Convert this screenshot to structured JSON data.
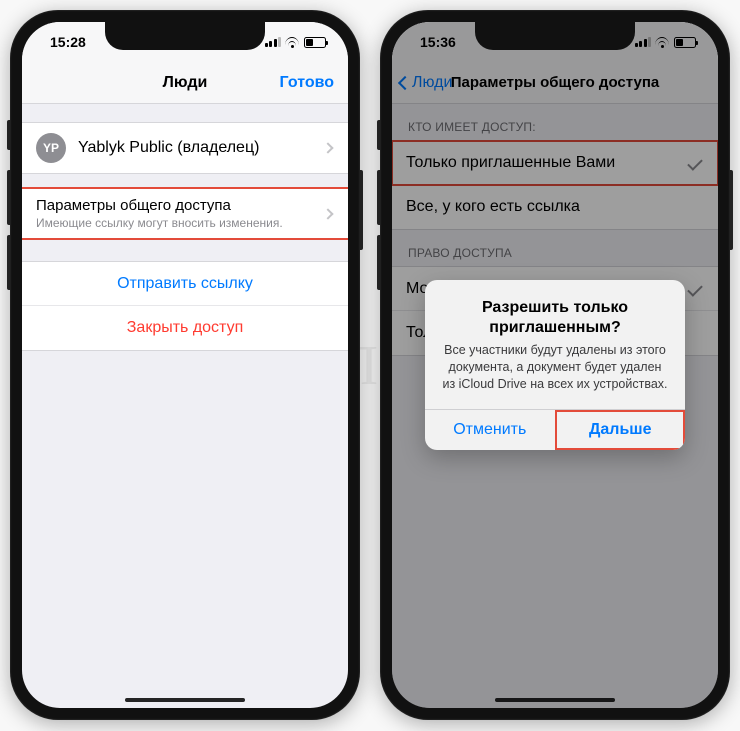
{
  "left": {
    "status_time": "15:28",
    "nav_title": "Люди",
    "nav_done": "Готово",
    "owner": {
      "initials": "YP",
      "name": "Yablyk Public (владелец)"
    },
    "sharing": {
      "title": "Параметры общего доступа",
      "subtitle": "Имеющие ссылку могут вносить изменения."
    },
    "send_link": "Отправить ссылку",
    "stop_sharing": "Закрыть доступ"
  },
  "right": {
    "status_time": "15:36",
    "back_label": "Люди",
    "nav_title": "Параметры общего доступа",
    "section_access": "КТО ИМЕЕТ ДОСТУП:",
    "opt_invited": "Только приглашенные Вами",
    "opt_anylink": "Все, у кого есть ссылка",
    "section_perm": "ПРАВО ДОСТУПА",
    "opt_edit": "Можно вносить изменения",
    "opt_view": "Только просмотр",
    "alert": {
      "title": "Разрешить только приглашенным?",
      "message": "Все участники будут удалены из этого документа, а документ будет удален из iCloud Drive на всех их устройствах.",
      "cancel": "Отменить",
      "confirm": "Дальше"
    }
  },
  "watermark": "ЯБЛЫК"
}
